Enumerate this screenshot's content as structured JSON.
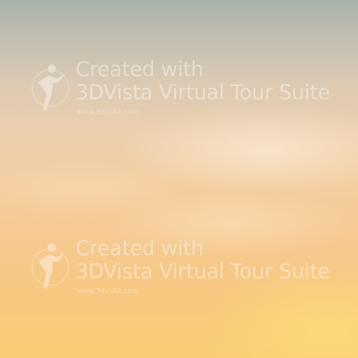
{
  "watermarks": [
    {
      "line1": "Created with",
      "line2": "3DVista Virtual Tour Suite",
      "url": "www.3dvista.com",
      "logo": "3dvista-logo"
    },
    {
      "line1": "Created with",
      "line2": "3DVista Virtual Tour Suite",
      "url": "www.3dvista.com",
      "logo": "3dvista-logo"
    }
  ],
  "colors": {
    "sky_top": "#a9b1ad",
    "sky_mid": "#f4cd9f",
    "sky_bottom": "#f9cd74",
    "watermark": "#ffffff"
  }
}
